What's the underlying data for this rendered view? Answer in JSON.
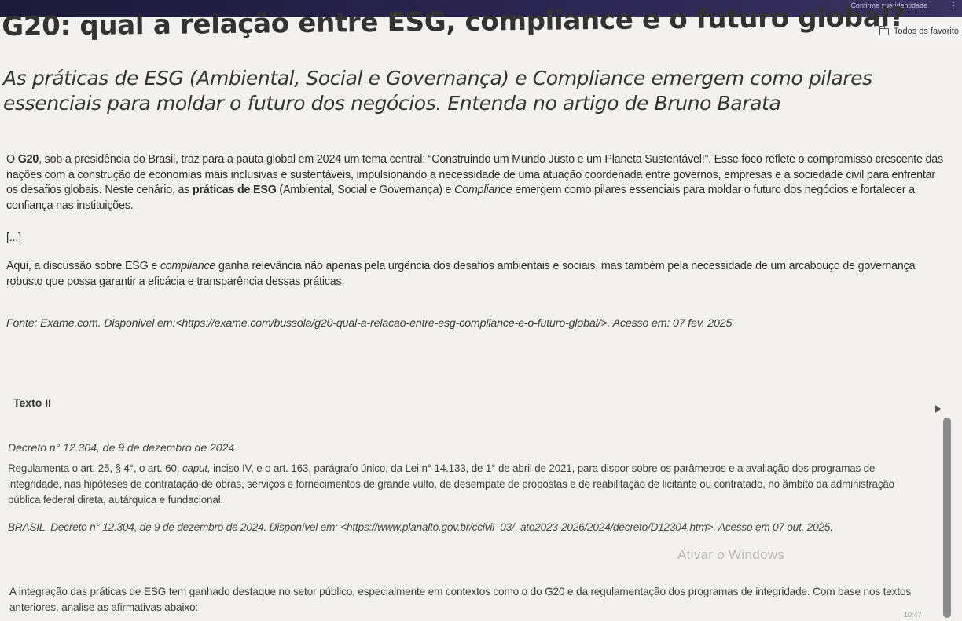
{
  "browser": {
    "identity_text": "Confirme sua identidade",
    "favorites_label": "Todos os favorito",
    "clock": "10:47"
  },
  "article": {
    "title": "G20: qual a relação entre ESG, compliance e o futuro global?",
    "subtitle": "As práticas de ESG (Ambiental, Social e Governança) e Compliance emergem como pilares essenciais para moldar o futuro dos negócios. Entenda no artigo de Bruno Barata",
    "p1_a": "O ",
    "p1_g20": "G20",
    "p1_b": ", sob a presidência do Brasil, traz para a pauta global em 2024 um tema central: “Construindo um Mundo Justo e um Planeta Sustentável!”. Esse foco reflete o compromisso crescente das nações com a construção de economias mais inclusivas e sustentáveis, impulsionando a necessidade de uma atuação coordenada entre governos, empresas e a sociedade civil para enfrentar os desafios globais. Neste cenário, as ",
    "p1_esg": "práticas de ESG",
    "p1_c": " (Ambiental, Social e Governança) e ",
    "p1_compliance": "Compliance",
    "p1_d": " emergem como pilares essenciais para moldar o futuro dos negócios e fortalecer a confiança nas instituições.",
    "ellipsis": "[...]",
    "p2_a": "Aqui, a discussão sobre ESG e ",
    "p2_compliance": "compliance",
    "p2_b": " ganha relevância não apenas pela urgência dos desafios ambientais e sociais, mas também pela necessidade de um arcabouço de governança robusto que possa garantir a eficácia e transparência dessas práticas.",
    "source": "Fonte: Exame.com. Disponivel em:<https://exame.com/bussola/g20-qual-a-relacao-entre-esg-compliance-e-o-futuro-global/>. Acesso em: 07 fev. 2025"
  },
  "text2": {
    "label": "Texto II",
    "decree_title": "Decreto n° 12.304, de 9 de dezembro de 2024",
    "decree_a": "Regulamenta o art. 25, § 4°, o art. 60, ",
    "decree_caput": "caput,",
    "decree_b": " inciso IV, e o art. 163, parágrafo único, da Lei n° 14.133, de 1° de abril de 2021, para dispor sobre os parâmetros e a avaliação dos programas de integridade, nas hipóteses de contratação de obras, serviços e fornecimentos de grande vulto, de desempate de propostas e de reabilitação de licitante ou contratado, no âmbito da administração pública federal direta, autárquica e fundacional.",
    "source": "BRASIL. Decreto n° 12.304, de 9 de dezembro de 2024. Disponível em: <https://www.planalto.gov.br/ccivil_03/_ato2023-2026/2024/decreto/D12304.htm>. Acesso em 07 out. 2025."
  },
  "question": {
    "text": "A integração das práticas de ESG tem ganhado destaque no setor público, especialmente em contextos como o do G20 e da regulamentação dos programas de integridade. Com base nos textos anteriores, analise as afirmativas abaixo:"
  },
  "overlay": {
    "watermark": "Ativar o Windows"
  }
}
